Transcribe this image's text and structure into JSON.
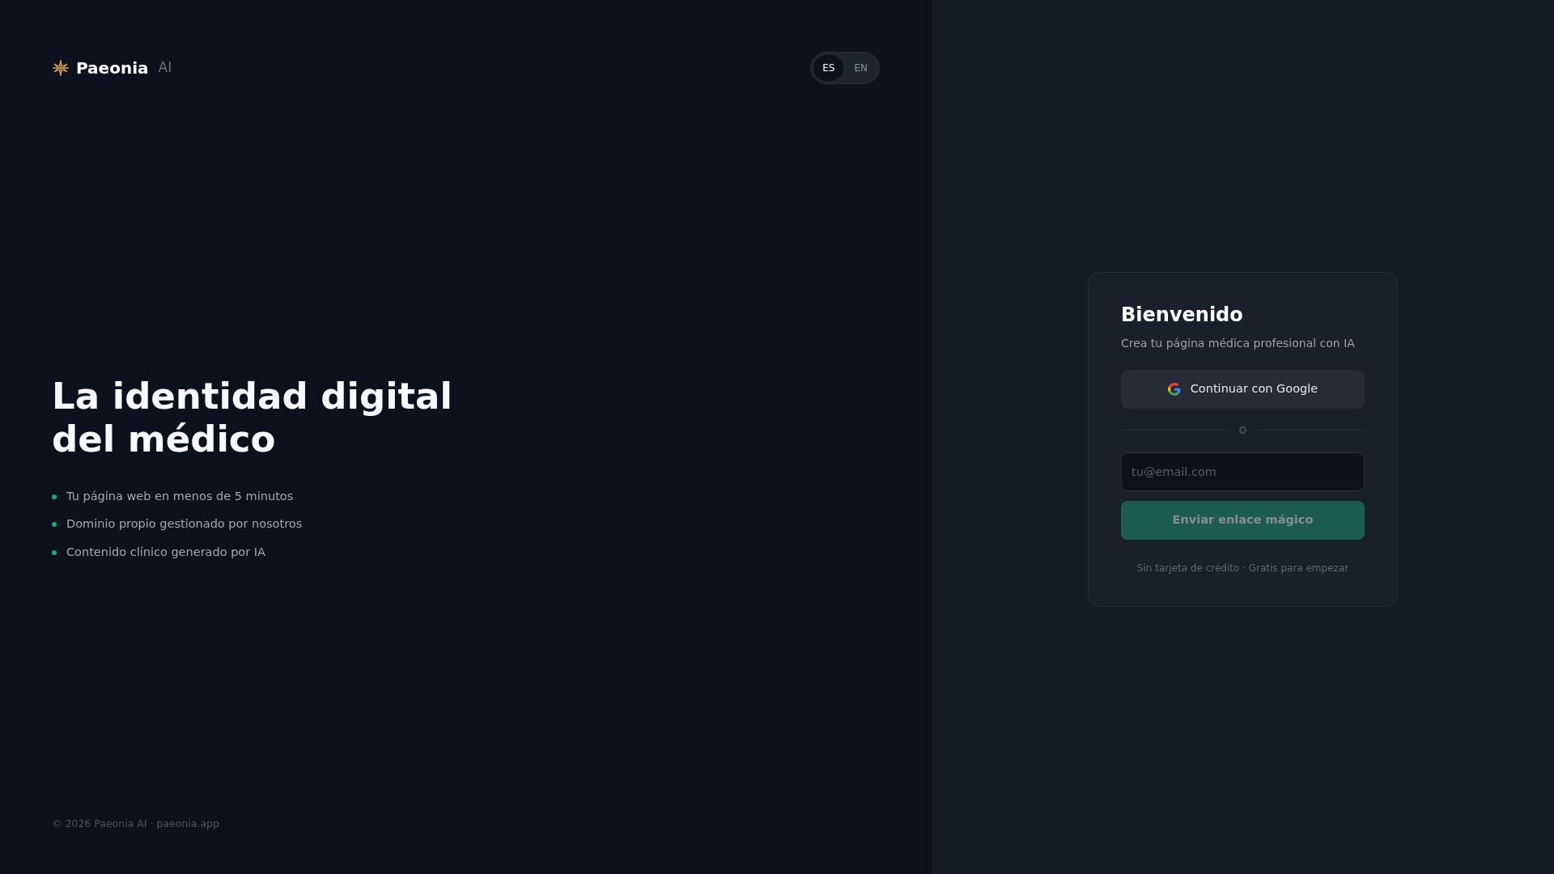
{
  "brand": {
    "name": "Paeonia",
    "suffix": "AI"
  },
  "languages": [
    {
      "label": "ES",
      "selected": true
    },
    {
      "label": "EN",
      "selected": false
    }
  ],
  "hero": {
    "headline_lines": [
      "La identidad digital",
      "del médico"
    ],
    "features": [
      "Tu página web en menos de 5 minutos",
      "Dominio propio gestionado por nosotros",
      "Contenido clínico generado por IA"
    ]
  },
  "footer": "© 2026 Paeonia AI · paeonia.app",
  "login": {
    "title": "Bienvenido",
    "subtitle": "Crea tu página médica profesional con IA",
    "google_button": "Continuar con Google",
    "divider": "O",
    "email": {
      "placeholder": "tu@email.com"
    },
    "submit": {
      "label": "Enviar enlace mágico",
      "disabled": true
    },
    "note": "Sin tarjeta de crédito · Gratis para empezar"
  }
}
